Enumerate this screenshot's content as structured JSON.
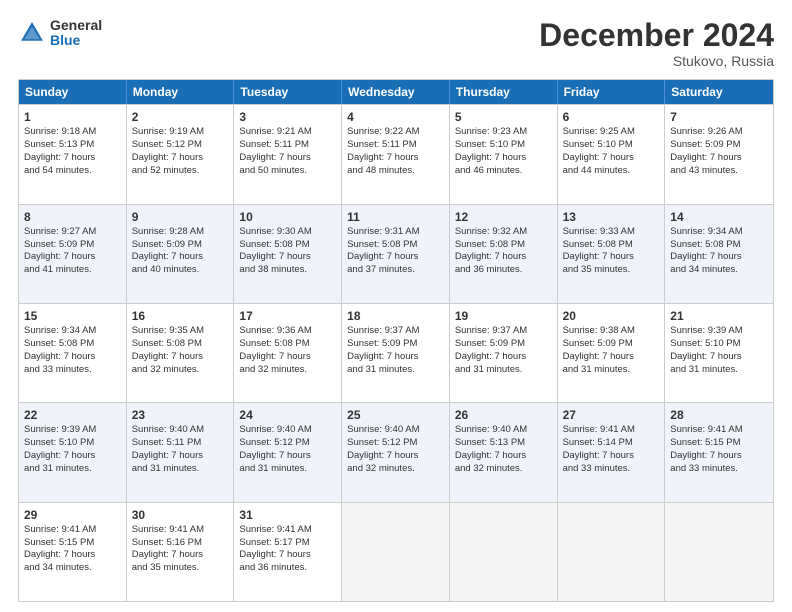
{
  "logo": {
    "general": "General",
    "blue": "Blue"
  },
  "header": {
    "month": "December 2024",
    "location": "Stukovo, Russia"
  },
  "days": [
    "Sunday",
    "Monday",
    "Tuesday",
    "Wednesday",
    "Thursday",
    "Friday",
    "Saturday"
  ],
  "weeks": [
    [
      {
        "day": 1,
        "lines": [
          "Sunrise: 9:18 AM",
          "Sunset: 5:13 PM",
          "Daylight: 7 hours",
          "and 54 minutes."
        ]
      },
      {
        "day": 2,
        "lines": [
          "Sunrise: 9:19 AM",
          "Sunset: 5:12 PM",
          "Daylight: 7 hours",
          "and 52 minutes."
        ]
      },
      {
        "day": 3,
        "lines": [
          "Sunrise: 9:21 AM",
          "Sunset: 5:11 PM",
          "Daylight: 7 hours",
          "and 50 minutes."
        ]
      },
      {
        "day": 4,
        "lines": [
          "Sunrise: 9:22 AM",
          "Sunset: 5:11 PM",
          "Daylight: 7 hours",
          "and 48 minutes."
        ]
      },
      {
        "day": 5,
        "lines": [
          "Sunrise: 9:23 AM",
          "Sunset: 5:10 PM",
          "Daylight: 7 hours",
          "and 46 minutes."
        ]
      },
      {
        "day": 6,
        "lines": [
          "Sunrise: 9:25 AM",
          "Sunset: 5:10 PM",
          "Daylight: 7 hours",
          "and 44 minutes."
        ]
      },
      {
        "day": 7,
        "lines": [
          "Sunrise: 9:26 AM",
          "Sunset: 5:09 PM",
          "Daylight: 7 hours",
          "and 43 minutes."
        ]
      }
    ],
    [
      {
        "day": 8,
        "lines": [
          "Sunrise: 9:27 AM",
          "Sunset: 5:09 PM",
          "Daylight: 7 hours",
          "and 41 minutes."
        ]
      },
      {
        "day": 9,
        "lines": [
          "Sunrise: 9:28 AM",
          "Sunset: 5:09 PM",
          "Daylight: 7 hours",
          "and 40 minutes."
        ]
      },
      {
        "day": 10,
        "lines": [
          "Sunrise: 9:30 AM",
          "Sunset: 5:08 PM",
          "Daylight: 7 hours",
          "and 38 minutes."
        ]
      },
      {
        "day": 11,
        "lines": [
          "Sunrise: 9:31 AM",
          "Sunset: 5:08 PM",
          "Daylight: 7 hours",
          "and 37 minutes."
        ]
      },
      {
        "day": 12,
        "lines": [
          "Sunrise: 9:32 AM",
          "Sunset: 5:08 PM",
          "Daylight: 7 hours",
          "and 36 minutes."
        ]
      },
      {
        "day": 13,
        "lines": [
          "Sunrise: 9:33 AM",
          "Sunset: 5:08 PM",
          "Daylight: 7 hours",
          "and 35 minutes."
        ]
      },
      {
        "day": 14,
        "lines": [
          "Sunrise: 9:34 AM",
          "Sunset: 5:08 PM",
          "Daylight: 7 hours",
          "and 34 minutes."
        ]
      }
    ],
    [
      {
        "day": 15,
        "lines": [
          "Sunrise: 9:34 AM",
          "Sunset: 5:08 PM",
          "Daylight: 7 hours",
          "and 33 minutes."
        ]
      },
      {
        "day": 16,
        "lines": [
          "Sunrise: 9:35 AM",
          "Sunset: 5:08 PM",
          "Daylight: 7 hours",
          "and 32 minutes."
        ]
      },
      {
        "day": 17,
        "lines": [
          "Sunrise: 9:36 AM",
          "Sunset: 5:08 PM",
          "Daylight: 7 hours",
          "and 32 minutes."
        ]
      },
      {
        "day": 18,
        "lines": [
          "Sunrise: 9:37 AM",
          "Sunset: 5:09 PM",
          "Daylight: 7 hours",
          "and 31 minutes."
        ]
      },
      {
        "day": 19,
        "lines": [
          "Sunrise: 9:37 AM",
          "Sunset: 5:09 PM",
          "Daylight: 7 hours",
          "and 31 minutes."
        ]
      },
      {
        "day": 20,
        "lines": [
          "Sunrise: 9:38 AM",
          "Sunset: 5:09 PM",
          "Daylight: 7 hours",
          "and 31 minutes."
        ]
      },
      {
        "day": 21,
        "lines": [
          "Sunrise: 9:39 AM",
          "Sunset: 5:10 PM",
          "Daylight: 7 hours",
          "and 31 minutes."
        ]
      }
    ],
    [
      {
        "day": 22,
        "lines": [
          "Sunrise: 9:39 AM",
          "Sunset: 5:10 PM",
          "Daylight: 7 hours",
          "and 31 minutes."
        ]
      },
      {
        "day": 23,
        "lines": [
          "Sunrise: 9:40 AM",
          "Sunset: 5:11 PM",
          "Daylight: 7 hours",
          "and 31 minutes."
        ]
      },
      {
        "day": 24,
        "lines": [
          "Sunrise: 9:40 AM",
          "Sunset: 5:12 PM",
          "Daylight: 7 hours",
          "and 31 minutes."
        ]
      },
      {
        "day": 25,
        "lines": [
          "Sunrise: 9:40 AM",
          "Sunset: 5:12 PM",
          "Daylight: 7 hours",
          "and 32 minutes."
        ]
      },
      {
        "day": 26,
        "lines": [
          "Sunrise: 9:40 AM",
          "Sunset: 5:13 PM",
          "Daylight: 7 hours",
          "and 32 minutes."
        ]
      },
      {
        "day": 27,
        "lines": [
          "Sunrise: 9:41 AM",
          "Sunset: 5:14 PM",
          "Daylight: 7 hours",
          "and 33 minutes."
        ]
      },
      {
        "day": 28,
        "lines": [
          "Sunrise: 9:41 AM",
          "Sunset: 5:15 PM",
          "Daylight: 7 hours",
          "and 33 minutes."
        ]
      }
    ],
    [
      {
        "day": 29,
        "lines": [
          "Sunrise: 9:41 AM",
          "Sunset: 5:15 PM",
          "Daylight: 7 hours",
          "and 34 minutes."
        ]
      },
      {
        "day": 30,
        "lines": [
          "Sunrise: 9:41 AM",
          "Sunset: 5:16 PM",
          "Daylight: 7 hours",
          "and 35 minutes."
        ]
      },
      {
        "day": 31,
        "lines": [
          "Sunrise: 9:41 AM",
          "Sunset: 5:17 PM",
          "Daylight: 7 hours",
          "and 36 minutes."
        ]
      },
      null,
      null,
      null,
      null
    ]
  ]
}
